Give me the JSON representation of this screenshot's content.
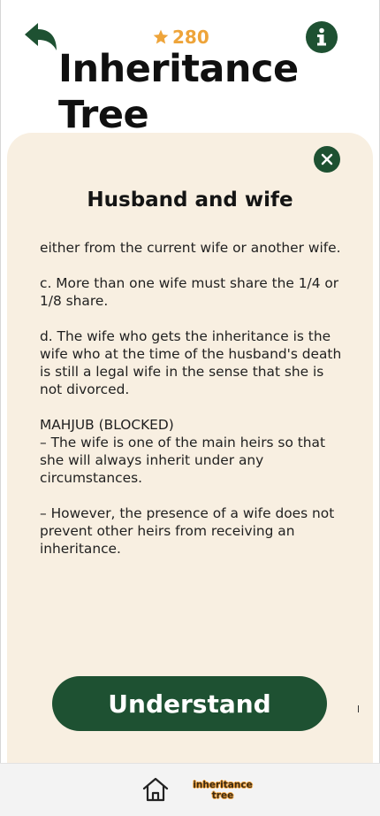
{
  "header": {
    "score": "280",
    "title": "Inheritance Tree"
  },
  "modal": {
    "title": "Husband and wife",
    "paragraphs": [
      "either from the current wife or another wife.",
      "c. More than one wife must share the 1/4 or 1/8 share.",
      "d. The wife who gets the inheritance is the wife who at the time of the husband's death is still a legal wife in the sense that she is not divorced.",
      "MAHJUB (BLOCKED)",
      "– The wife is one of the main heirs so that she will always inherit under any circumstances.",
      "– However, the presence of a wife does not prevent other heirs from receiving an inheritance."
    ],
    "button_label": "Understand"
  },
  "bottom_nav": {
    "logo_line1": "inheritance",
    "logo_line2": "tree"
  },
  "colors": {
    "primary": "#1e5132",
    "accent": "#eea43a",
    "modal_bg": "#f8efe1"
  },
  "icons": {
    "back": "back-arrow-icon",
    "star": "star-icon",
    "info": "info-icon",
    "close": "close-icon",
    "home": "home-icon"
  }
}
